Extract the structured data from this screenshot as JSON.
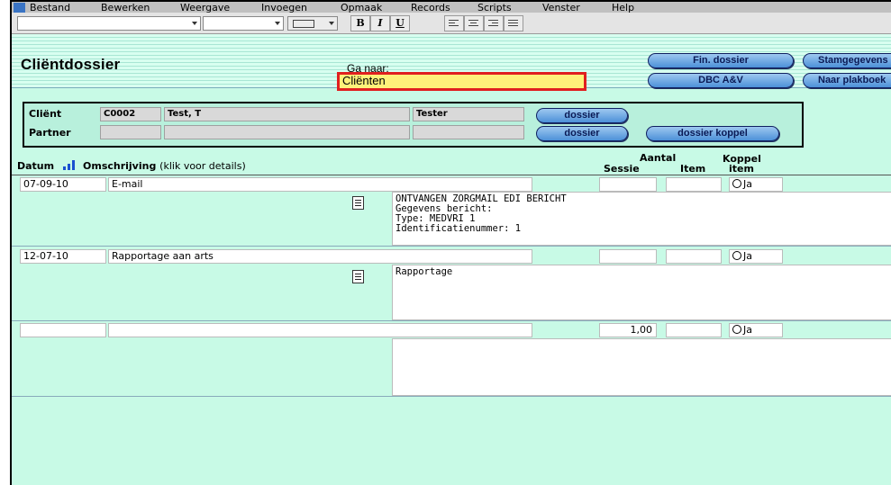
{
  "menu": [
    "Bestand",
    "Bewerken",
    "Weergave",
    "Invoegen",
    "Opmaak",
    "Records",
    "Scripts",
    "Venster",
    "Help"
  ],
  "toolbar": {
    "bold": "B",
    "italic": "I",
    "underline": "U"
  },
  "header": {
    "title": "Cliëntdossier",
    "goto_label": "Ga naar:",
    "goto_value": "Cliënten",
    "btn_fin": "Fin. dossier",
    "btn_stam": "Stamgegevens",
    "btn_dbc": "DBC A&V",
    "btn_plak": "Naar plakboek"
  },
  "client": {
    "client_label": "Cliënt",
    "client_code": "C0002",
    "client_name": "Test, T",
    "client_role": "Tester",
    "partner_label": "Partner",
    "btn_dossier_client": "dossier",
    "btn_dossier_partner": "dossier",
    "btn_dossier_koppel": "dossier koppel"
  },
  "columns": {
    "datum": "Datum",
    "omschrijving": "Omschrijving",
    "omschrijving_hint": "(klik voor details)",
    "aantal": "Aantal",
    "sessie": "Sessie",
    "item": "Item",
    "koppel": "Koppel",
    "koppel_item": "item"
  },
  "rows": [
    {
      "datum": "07-09-10",
      "omschrijving": "E-mail",
      "aantal": "",
      "item": "",
      "koppel": "Ja",
      "details": "ONTVANGEN ZORGMAIL EDI BERICHT\nGegevens bericht:\nType: MEDVRI 1\nIdentificatienummer: 1"
    },
    {
      "datum": "12-07-10",
      "omschrijving": "Rapportage aan arts",
      "aantal": "",
      "item": "",
      "koppel": "Ja",
      "details": "Rapportage"
    },
    {
      "datum": "",
      "omschrijving": "",
      "aantal": "1,00",
      "item": "",
      "koppel": "Ja",
      "details": ""
    }
  ],
  "colors": {
    "background": "#c8fae6",
    "highlight_border": "#e02020",
    "goto_fill": "#fff27a",
    "button_blue": "#4c90d8"
  }
}
